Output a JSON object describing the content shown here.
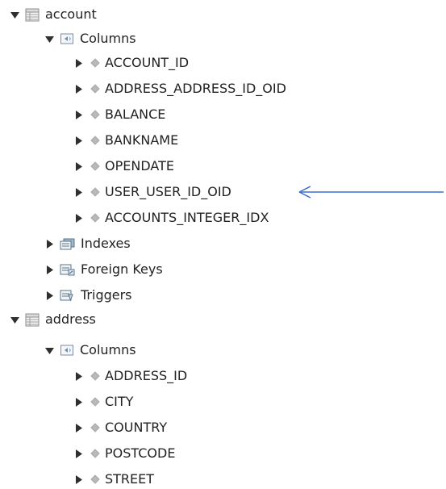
{
  "tree": {
    "tables": [
      {
        "name": "account",
        "columns_label": "Columns",
        "columns": [
          "ACCOUNT_ID",
          "ADDRESS_ADDRESS_ID_OID",
          "BALANCE",
          "BANKNAME",
          "OPENDATE",
          "USER_USER_ID_OID",
          "ACCOUNTS_INTEGER_IDX"
        ],
        "indexes_label": "Indexes",
        "foreign_keys_label": "Foreign Keys",
        "triggers_label": "Triggers"
      },
      {
        "name": "address",
        "columns_label": "Columns",
        "columns": [
          "ADDRESS_ID",
          "CITY",
          "COUNTRY",
          "POSTCODE",
          "STREET"
        ]
      }
    ]
  },
  "colors": {
    "toggle": "#2f2f2f",
    "arrow": "#3d6fd1",
    "table_icon": "#8c8c8c",
    "folder_icon": "#6f8ea8",
    "diamond": "#b8b8b8"
  }
}
